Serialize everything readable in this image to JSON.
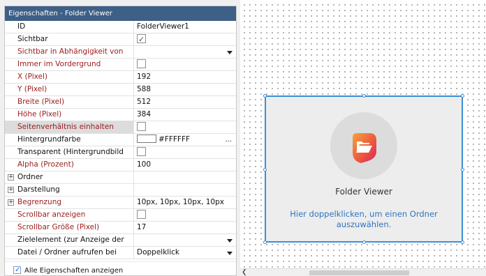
{
  "panel": {
    "title": "Eigenschaften - Folder Viewer"
  },
  "properties": [
    {
      "name": "ID",
      "value": "FolderViewer1",
      "red": false,
      "kind": "text"
    },
    {
      "name": "Sichtbar",
      "value": "",
      "red": false,
      "kind": "check",
      "checked": true
    },
    {
      "name": "Sichtbar in Abhängigkeit von",
      "value": "",
      "red": true,
      "kind": "dropdown"
    },
    {
      "name": "Immer im Vordergrund",
      "value": "",
      "red": true,
      "kind": "check",
      "checked": false
    },
    {
      "name": "X (Pixel)",
      "value": "192",
      "red": true,
      "kind": "text"
    },
    {
      "name": "Y (Pixel)",
      "value": "588",
      "red": true,
      "kind": "text"
    },
    {
      "name": "Breite (Pixel)",
      "value": "512",
      "red": true,
      "kind": "text"
    },
    {
      "name": "Höhe (Pixel)",
      "value": "384",
      "red": true,
      "kind": "text"
    },
    {
      "name": "Seitenverhältnis einhalten",
      "value": "",
      "red": true,
      "kind": "check",
      "checked": false,
      "highlight": true
    },
    {
      "name": "Hintergrundfarbe",
      "value": "#FFFFFF",
      "red": false,
      "kind": "color",
      "ellipsis": "..."
    },
    {
      "name": "Transparent (Hintergrundbild",
      "value": "",
      "red": false,
      "kind": "check",
      "checked": false
    },
    {
      "name": "Alpha (Prozent)",
      "value": "100",
      "red": true,
      "kind": "text"
    },
    {
      "name": "Ordner",
      "value": "",
      "red": false,
      "kind": "group"
    },
    {
      "name": "Darstellung",
      "value": "",
      "red": false,
      "kind": "group"
    },
    {
      "name": "Begrenzung",
      "value": "10px, 10px, 10px, 10px",
      "red": true,
      "kind": "group"
    },
    {
      "name": "Scrollbar anzeigen",
      "value": "",
      "red": true,
      "kind": "check",
      "checked": false
    },
    {
      "name": "Scrollbar Größe (Pixel)",
      "value": "17",
      "red": true,
      "kind": "text"
    },
    {
      "name": "Zielelement (zur Anzeige der",
      "value": "",
      "red": false,
      "kind": "dropdown"
    },
    {
      "name": "Datei / Ordner aufrufen bei",
      "value": "Doppelklick",
      "red": false,
      "kind": "dropdown"
    }
  ],
  "footer": {
    "show_all_label": "Alle Eigenschaften anzeigen",
    "show_all_checked": true
  },
  "widget": {
    "title": "Folder Viewer",
    "hint": "Hier doppelklicken, um einen Ordner auszuwählen."
  },
  "colors": {
    "accent": "#3a8fd8",
    "title_bar": "#3e5f86",
    "required_label": "#9b1b1b",
    "hint_text": "#2f74c0"
  },
  "icons": {
    "widget_icon": "folder-open-icon",
    "expander": "plus-icon",
    "scroll_left": "arrow-left-icon"
  }
}
